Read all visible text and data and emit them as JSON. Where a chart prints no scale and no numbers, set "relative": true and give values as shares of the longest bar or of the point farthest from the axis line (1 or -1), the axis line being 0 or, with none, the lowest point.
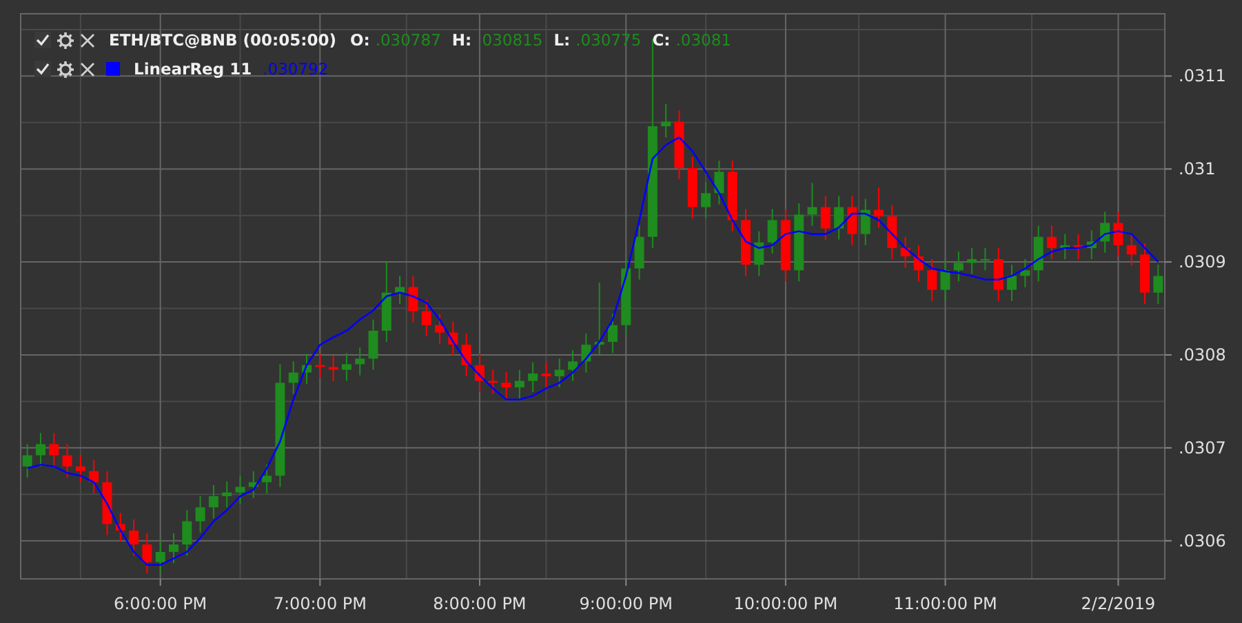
{
  "legend": [
    {
      "kind": "instrument",
      "checked": true,
      "title": "ETH/BTC@BNB (00:05:00)",
      "fields": [
        {
          "label": "O:",
          "value": ".030787"
        },
        {
          "label": "H:",
          "value": ".030815"
        },
        {
          "label": "L:",
          "value": ".030775"
        },
        {
          "label": "C:",
          "value": ".03081"
        }
      ]
    },
    {
      "kind": "indicator",
      "checked": true,
      "value": ".030792"
    }
  ],
  "chart": {
    "chart_data": {
      "type": "candlestick",
      "categories": [
        null,
        null,
        null,
        null,
        null,
        null,
        null,
        null,
        null,
        null,
        "6:00:00 PM",
        null,
        null,
        null,
        null,
        null,
        null,
        null,
        null,
        null,
        null,
        null,
        "7:00:00 PM",
        null,
        null,
        null,
        null,
        null,
        null,
        null,
        null,
        null,
        null,
        null,
        "8:00:00 PM",
        null,
        null,
        null,
        null,
        null,
        null,
        null,
        null,
        null,
        null,
        "9:00:00 PM",
        null,
        null,
        null,
        null,
        null,
        null,
        null,
        null,
        null,
        null,
        null,
        "10:00:00 PM",
        null,
        null,
        null,
        null,
        null,
        null,
        null,
        null,
        null,
        null,
        null,
        "11:00:00 PM",
        null,
        null,
        null,
        null,
        null,
        null,
        null,
        null,
        null,
        null,
        null,
        null,
        "2/2/2019",
        null,
        null,
        null
      ],
      "ylim": [
        0.030559,
        0.031167
      ],
      "grid": true,
      "yticks": [
        {
          "value": 0.0311,
          "label": ".0311"
        },
        {
          "value": 0.031,
          "label": ".031"
        },
        {
          "value": 0.0309,
          "label": ".0309"
        },
        {
          "value": 0.0308,
          "label": ".0308"
        },
        {
          "value": 0.0307,
          "label": ".0307"
        },
        {
          "value": 0.0306,
          "label": ".0306"
        }
      ],
      "ohlc": [
        [
          0.03068,
          0.030704,
          0.030668,
          0.030692
        ],
        [
          0.030692,
          0.030716,
          0.03068,
          0.030704
        ],
        [
          0.030704,
          0.030716,
          0.03068,
          0.030692
        ],
        [
          0.030692,
          0.030704,
          0.030668,
          0.03068
        ],
        [
          0.03068,
          0.030692,
          0.030663,
          0.030675
        ],
        [
          0.030675,
          0.030687,
          0.030651,
          0.030663
        ],
        [
          0.030663,
          0.030675,
          0.030606,
          0.030618
        ],
        [
          0.030618,
          0.03063,
          0.030599,
          0.030611
        ],
        [
          0.030611,
          0.030623,
          0.030584,
          0.030596
        ],
        [
          0.030596,
          0.030608,
          0.030565,
          0.030577
        ],
        [
          0.030577,
          0.0306,
          0.030565,
          0.030588
        ],
        [
          0.030588,
          0.030608,
          0.030576,
          0.030596
        ],
        [
          0.030596,
          0.030633,
          0.030584,
          0.030621
        ],
        [
          0.030621,
          0.030648,
          0.030609,
          0.030636
        ],
        [
          0.030636,
          0.03066,
          0.030624,
          0.030648
        ],
        [
          0.030648,
          0.030664,
          0.030636,
          0.030652
        ],
        [
          0.030652,
          0.03067,
          0.03064,
          0.030658
        ],
        [
          0.030658,
          0.030675,
          0.030646,
          0.030663
        ],
        [
          0.030663,
          0.030682,
          0.030651,
          0.03067
        ],
        [
          0.03067,
          0.03079,
          0.030658,
          0.03077
        ],
        [
          0.03077,
          0.030793,
          0.030758,
          0.030781
        ],
        [
          0.030781,
          0.030801,
          0.030769,
          0.030789
        ],
        [
          0.030789,
          0.030801,
          0.030775,
          0.030787
        ],
        [
          0.030787,
          0.030799,
          0.030772,
          0.030784
        ],
        [
          0.030784,
          0.030802,
          0.030772,
          0.03079
        ],
        [
          0.03079,
          0.030808,
          0.030778,
          0.030796
        ],
        [
          0.030796,
          0.030838,
          0.030784,
          0.030826
        ],
        [
          0.030826,
          0.0309,
          0.030814,
          0.030867
        ],
        [
          0.030867,
          0.030885,
          0.030855,
          0.030873
        ],
        [
          0.030873,
          0.030885,
          0.030835,
          0.030847
        ],
        [
          0.030847,
          0.030859,
          0.03082,
          0.030832
        ],
        [
          0.030832,
          0.030844,
          0.030812,
          0.030824
        ],
        [
          0.030824,
          0.030836,
          0.030799,
          0.030811
        ],
        [
          0.030811,
          0.030823,
          0.030777,
          0.030789
        ],
        [
          0.030789,
          0.030801,
          0.03076,
          0.030772
        ],
        [
          0.030772,
          0.030784,
          0.030758,
          0.03077
        ],
        [
          0.03077,
          0.030782,
          0.030753,
          0.030765
        ],
        [
          0.030765,
          0.030784,
          0.030753,
          0.030772
        ],
        [
          0.030772,
          0.030792,
          0.03076,
          0.03078
        ],
        [
          0.03078,
          0.030792,
          0.030765,
          0.030777
        ],
        [
          0.030777,
          0.030796,
          0.030765,
          0.030784
        ],
        [
          0.030784,
          0.030805,
          0.030772,
          0.030793
        ],
        [
          0.030793,
          0.030823,
          0.030781,
          0.030811
        ],
        [
          0.030811,
          0.030878,
          0.030799,
          0.030814
        ],
        [
          0.030814,
          0.030844,
          0.030802,
          0.030832
        ],
        [
          0.030832,
          0.030905,
          0.03082,
          0.030893
        ],
        [
          0.030893,
          0.030939,
          0.030881,
          0.030927
        ],
        [
          0.030927,
          0.03114,
          0.030915,
          0.031046
        ],
        [
          0.031046,
          0.03107,
          0.031034,
          0.031051
        ],
        [
          0.031051,
          0.031063,
          0.030989,
          0.031001
        ],
        [
          0.031001,
          0.031013,
          0.030947,
          0.030959
        ],
        [
          0.030959,
          0.030986,
          0.030947,
          0.030974
        ],
        [
          0.030974,
          0.031009,
          0.030962,
          0.030997
        ],
        [
          0.030997,
          0.031009,
          0.030933,
          0.030945
        ],
        [
          0.030945,
          0.030957,
          0.030885,
          0.030897
        ],
        [
          0.030897,
          0.030933,
          0.030885,
          0.030921
        ],
        [
          0.030921,
          0.030957,
          0.030909,
          0.030945
        ],
        [
          0.030945,
          0.030957,
          0.030879,
          0.030891
        ],
        [
          0.030891,
          0.030963,
          0.030879,
          0.030951
        ],
        [
          0.030951,
          0.030985,
          0.030939,
          0.030959
        ],
        [
          0.030959,
          0.030971,
          0.030924,
          0.030936
        ],
        [
          0.030936,
          0.030971,
          0.030924,
          0.030959
        ],
        [
          0.030959,
          0.030971,
          0.030918,
          0.03093
        ],
        [
          0.03093,
          0.030968,
          0.030918,
          0.030956
        ],
        [
          0.030956,
          0.03098,
          0.030937,
          0.030949
        ],
        [
          0.030949,
          0.030961,
          0.030903,
          0.030915
        ],
        [
          0.030915,
          0.030927,
          0.030894,
          0.030906
        ],
        [
          0.030906,
          0.030918,
          0.030879,
          0.030891
        ],
        [
          0.030891,
          0.030903,
          0.030858,
          0.03087
        ],
        [
          0.03087,
          0.030903,
          0.030858,
          0.030891
        ],
        [
          0.030891,
          0.030911,
          0.030879,
          0.030899
        ],
        [
          0.030899,
          0.030915,
          0.030887,
          0.030903
        ],
        [
          0.030903,
          0.030915,
          0.030891,
          0.030903
        ],
        [
          0.030903,
          0.030915,
          0.030858,
          0.03087
        ],
        [
          0.03087,
          0.030897,
          0.030858,
          0.030885
        ],
        [
          0.030885,
          0.030903,
          0.030873,
          0.030891
        ],
        [
          0.030891,
          0.030939,
          0.030879,
          0.030927
        ],
        [
          0.030927,
          0.030939,
          0.030903,
          0.030915
        ],
        [
          0.030915,
          0.03093,
          0.030903,
          0.030918
        ],
        [
          0.030918,
          0.03093,
          0.030903,
          0.030915
        ],
        [
          0.030915,
          0.030934,
          0.030903,
          0.030922
        ],
        [
          0.030922,
          0.030954,
          0.03091,
          0.030942
        ],
        [
          0.030942,
          0.030954,
          0.030906,
          0.030918
        ],
        [
          0.030918,
          0.03093,
          0.030896,
          0.030908
        ],
        [
          0.030908,
          0.03092,
          0.030855,
          0.030867
        ],
        [
          0.030867,
          0.030897,
          0.030855,
          0.030885
        ]
      ]
    },
    "overlay": {
      "chart_data": {
        "type": "line",
        "relative": true,
        "ylim": [
          0.030559,
          0.031167
        ],
        "series": [
          {
            "name": "LinearReg 11",
            "color": "#0000ff",
            "values": [
              0.030678,
              0.030682,
              0.03068,
              0.030673,
              0.03067,
              0.030663,
              0.03064,
              0.030611,
              0.030588,
              0.030574,
              0.030574,
              0.030581,
              0.030588,
              0.030603,
              0.030621,
              0.030633,
              0.030648,
              0.030655,
              0.030678,
              0.030707,
              0.030752,
              0.030789,
              0.030811,
              0.030819,
              0.030826,
              0.030838,
              0.030848,
              0.030863,
              0.030867,
              0.030863,
              0.030856,
              0.030838,
              0.030814,
              0.030793,
              0.030778,
              0.030764,
              0.030752,
              0.030752,
              0.030756,
              0.030764,
              0.03077,
              0.030781,
              0.030796,
              0.030814,
              0.030838,
              0.030885,
              0.030945,
              0.031011,
              0.031026,
              0.031034,
              0.031019,
              0.030997,
              0.030974,
              0.030945,
              0.030922,
              0.030915,
              0.030918,
              0.03093,
              0.030933,
              0.03093,
              0.03093,
              0.030937,
              0.030952,
              0.030952,
              0.030945,
              0.03093,
              0.030915,
              0.030903,
              0.030893,
              0.03089,
              0.030888,
              0.030885,
              0.030881,
              0.030881,
              0.030885,
              0.030893,
              0.030903,
              0.030911,
              0.030915,
              0.030915,
              0.030918,
              0.03093,
              0.030933,
              0.03093,
              0.030915,
              0.0309
            ]
          }
        ]
      }
    }
  }
}
